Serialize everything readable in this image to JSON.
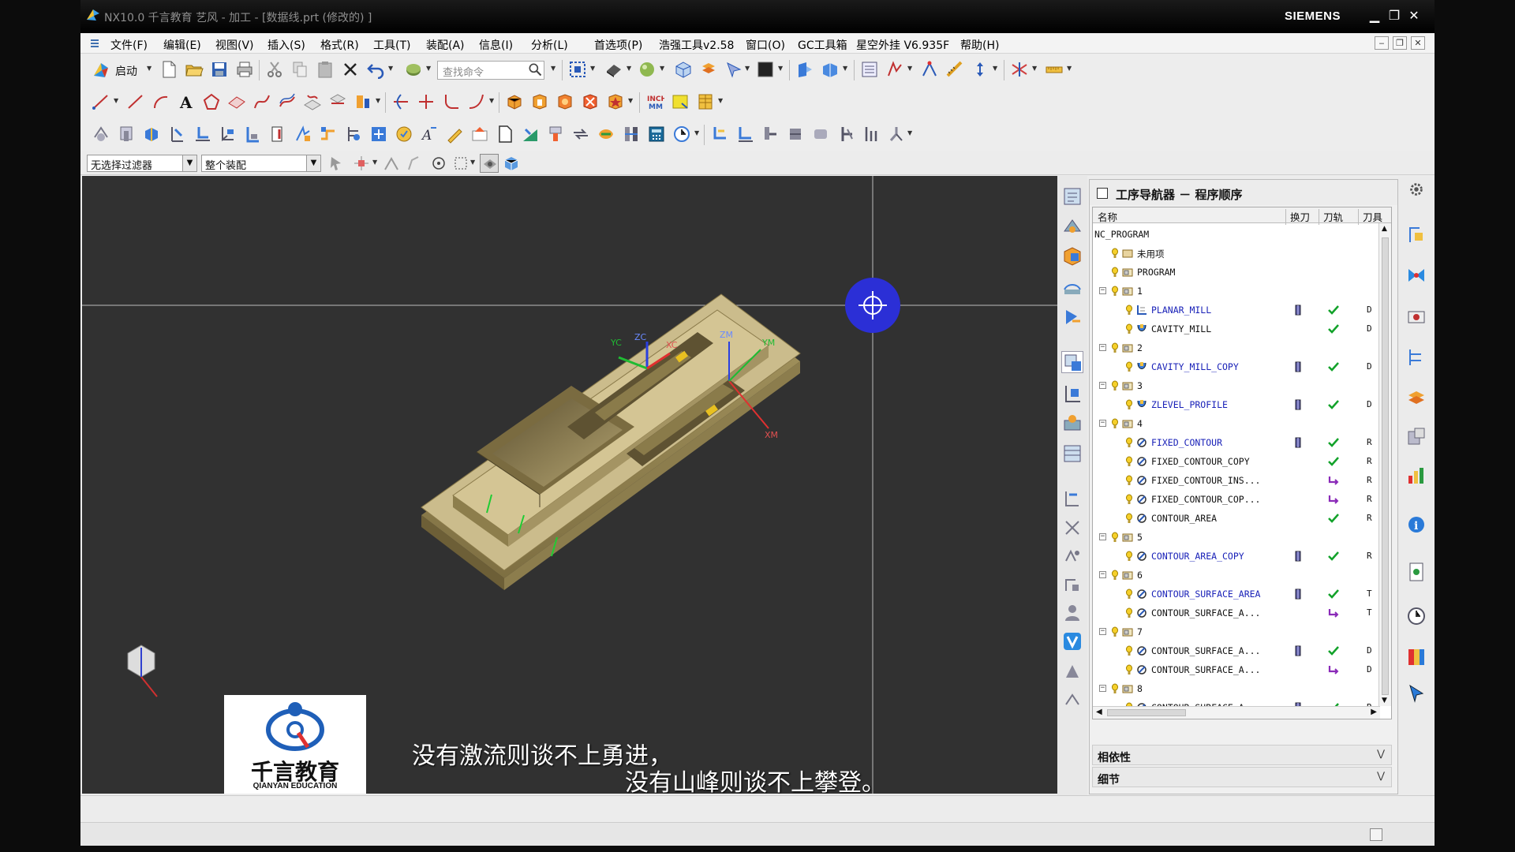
{
  "window": {
    "title": "NX10.0 千言教育 艺风 - 加工 - [数据线.prt  (修改的) ]",
    "brand": "SIEMENS",
    "controls": {
      "minimize": "▁",
      "maximize": "❐",
      "close": "✕"
    }
  },
  "menu": {
    "items": [
      "文件(F)",
      "编辑(E)",
      "视图(V)",
      "插入(S)",
      "格式(R)",
      "工具(T)",
      "装配(A)",
      "信息(I)",
      "分析(L)",
      "首选项(P)",
      "浩强工具v2.58",
      "窗口(O)",
      "GC工具箱",
      "星空外挂 V6.935F",
      "帮助(H)"
    ],
    "mdi_controls": [
      "‒",
      "❐",
      "✕"
    ]
  },
  "toolbar": {
    "start_label": "启动",
    "search_placeholder": "查找命令"
  },
  "selection_bar": {
    "filter": "无选择过滤器",
    "scope": "整个装配"
  },
  "viewport": {
    "subtitle_line1": "没有激流则谈不上勇进，",
    "subtitle_line2": "没有山峰则谈不上攀登。",
    "logo_cn": "千言教育",
    "logo_en": "QIANYAN EDUCATION",
    "axis_labels": {
      "xc": "XC",
      "yc": "YC",
      "zc": "ZC",
      "xm": "XM",
      "ym": "YM",
      "zm": "ZM"
    },
    "colors": {
      "background": "#313131",
      "part": "#c9b98a",
      "triad_center": "#2b2fd6"
    }
  },
  "navigator": {
    "title": "工序导航器 － 程序顺序",
    "columns": [
      "名称",
      "换刀",
      "刀轨",
      "刀具"
    ],
    "rows": [
      {
        "level": 0,
        "label": "NC_PROGRAM",
        "icon": "none"
      },
      {
        "level": 1,
        "label": "未用项",
        "icon": "folder"
      },
      {
        "level": 1,
        "label": "PROGRAM",
        "icon": "program"
      },
      {
        "level": 1,
        "label": "1",
        "icon": "program",
        "expand": "−"
      },
      {
        "level": 2,
        "label": "PLANAR_MILL",
        "icon": "planar",
        "blue": true,
        "tc": true,
        "status": "ok",
        "tool": "D"
      },
      {
        "level": 2,
        "label": "CAVITY_MILL",
        "icon": "cavity",
        "tc": false,
        "status": "ok",
        "tool": "D"
      },
      {
        "level": 1,
        "label": "2",
        "icon": "program",
        "expand": "−"
      },
      {
        "level": 2,
        "label": "CAVITY_MILL_COPY",
        "icon": "cavity",
        "blue": true,
        "tc": true,
        "status": "ok",
        "tool": "D"
      },
      {
        "level": 1,
        "label": "3",
        "icon": "program",
        "expand": "−"
      },
      {
        "level": 2,
        "label": "ZLEVEL_PROFILE",
        "icon": "cavity",
        "blue": true,
        "tc": true,
        "status": "ok",
        "tool": "D"
      },
      {
        "level": 1,
        "label": "4",
        "icon": "program",
        "expand": "−"
      },
      {
        "level": 2,
        "label": "FIXED_CONTOUR",
        "icon": "contour",
        "blue": true,
        "tc": true,
        "status": "ok",
        "tool": "R"
      },
      {
        "level": 2,
        "label": "FIXED_CONTOUR_COPY",
        "icon": "contour",
        "tc": false,
        "status": "ok",
        "tool": "R"
      },
      {
        "level": 2,
        "label": "FIXED_CONTOUR_INS...",
        "icon": "contour",
        "tc": false,
        "status": "regen",
        "tool": "R"
      },
      {
        "level": 2,
        "label": "FIXED_CONTOUR_COP...",
        "icon": "contour",
        "tc": false,
        "status": "regen",
        "tool": "R"
      },
      {
        "level": 2,
        "label": "CONTOUR_AREA",
        "icon": "contour",
        "tc": false,
        "status": "ok",
        "tool": "R"
      },
      {
        "level": 1,
        "label": "5",
        "icon": "program",
        "expand": "−"
      },
      {
        "level": 2,
        "label": "CONTOUR_AREA_COPY",
        "icon": "contour",
        "blue": true,
        "tc": true,
        "status": "ok",
        "tool": "R"
      },
      {
        "level": 1,
        "label": "6",
        "icon": "program",
        "expand": "−"
      },
      {
        "level": 2,
        "label": "CONTOUR_SURFACE_AREA",
        "icon": "contour",
        "blue": true,
        "tc": true,
        "status": "ok",
        "tool": "T"
      },
      {
        "level": 2,
        "label": "CONTOUR_SURFACE_A...",
        "icon": "contour",
        "tc": false,
        "status": "regen",
        "tool": "T"
      },
      {
        "level": 1,
        "label": "7",
        "icon": "program",
        "expand": "−"
      },
      {
        "level": 2,
        "label": "CONTOUR_SURFACE_A...",
        "icon": "contour",
        "tc": true,
        "status": "ok",
        "tool": "D"
      },
      {
        "level": 2,
        "label": "CONTOUR_SURFACE_A...",
        "icon": "contour",
        "tc": false,
        "status": "regen",
        "tool": "D"
      },
      {
        "level": 1,
        "label": "8",
        "icon": "program",
        "expand": "−"
      },
      {
        "level": 2,
        "label": "CONTOUR_SURFACE_A...",
        "icon": "contour",
        "tc": true,
        "status": "ok",
        "tool": "R"
      }
    ],
    "sections": [
      "相依性",
      "细节"
    ]
  }
}
